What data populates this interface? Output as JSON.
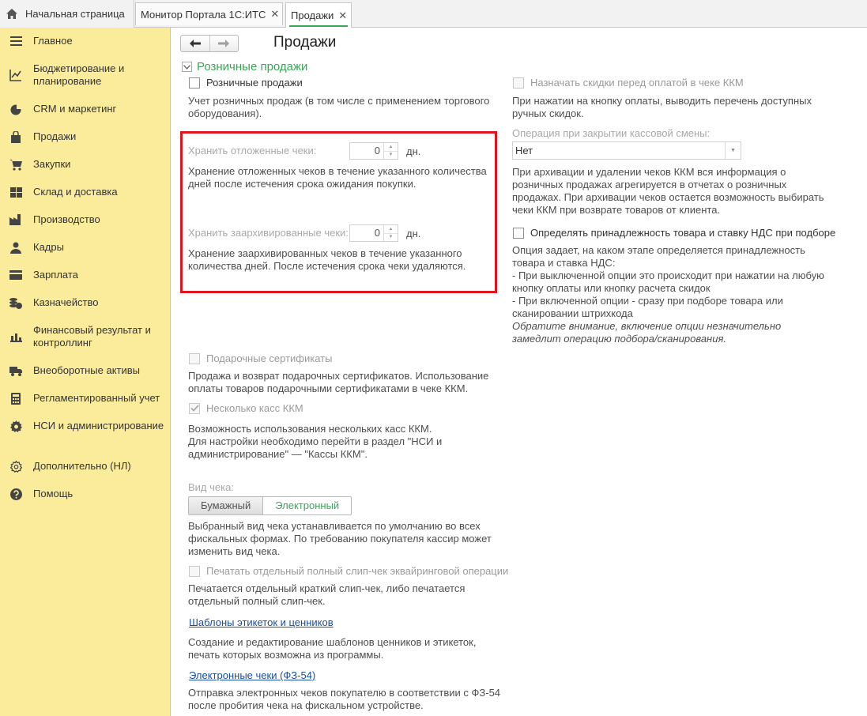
{
  "tabs": {
    "home": "Начальная страница",
    "portal_monitor": "Монитор Портала 1С:ИТС",
    "sales": "Продажи",
    "close_glyph": "✕"
  },
  "sidebar": {
    "items": [
      {
        "label": "Главное",
        "icon": "menu-lines-icon"
      },
      {
        "label": "Бюджетирование и планирование",
        "icon": "budget-chart-icon"
      },
      {
        "label": "CRM и маркетинг",
        "icon": "pie-chart-icon"
      },
      {
        "label": "Продажи",
        "icon": "shopping-bag-icon"
      },
      {
        "label": "Закупки",
        "icon": "cart-icon"
      },
      {
        "label": "Склад и доставка",
        "icon": "warehouse-grid-icon"
      },
      {
        "label": "Производство",
        "icon": "factory-icon"
      },
      {
        "label": "Кадры",
        "icon": "person-icon"
      },
      {
        "label": "Зарплата",
        "icon": "wallet-icon"
      },
      {
        "label": "Казначейство",
        "icon": "coins-icon"
      },
      {
        "label": "Финансовый результат и контроллинг",
        "icon": "bar-chart-icon"
      },
      {
        "label": "Внеоборотные активы",
        "icon": "truck-icon"
      },
      {
        "label": "Регламентированный учет",
        "icon": "calculator-icon"
      },
      {
        "label": "НСИ и администрирование",
        "icon": "gear-icon"
      },
      {
        "label": "Дополнительно (НЛ)",
        "icon": "gear-outline-icon"
      },
      {
        "label": "Помощь",
        "icon": "question-icon"
      }
    ]
  },
  "page": {
    "title": "Продажи",
    "group_title": "Розничные продажи",
    "retail_sales_checkbox": "Розничные продажи",
    "retail_sales_desc": [
      "Учет розничных продаж (в том числе с применением торгового",
      "оборудования)."
    ],
    "keep_deferred_label": "Хранить отложенные чеки:",
    "keep_deferred_value": "0",
    "keep_deferred_unit": "дн.",
    "keep_deferred_desc": [
      "Хранение отложенных чеков в течение указанного количества",
      "дней после истечения срока ожидания покупки."
    ],
    "keep_archived_label": "Хранить заархивированные чеки:",
    "keep_archived_value": "0",
    "keep_archived_unit": "дн.",
    "keep_archived_desc": [
      "Хранение заархивированных чеков в течение указанного",
      "количества дней. После истечения срока чеки удаляются."
    ],
    "gift_cert_checkbox": "Подарочные сертификаты",
    "gift_cert_desc": [
      "Продажа и возврат подарочных сертификатов. Использование",
      "оплаты товаров подарочными сертификатами в чеке ККМ."
    ],
    "multi_kkm_checkbox": "Несколько касс ККМ",
    "multi_kkm_desc": [
      "Возможность использования нескольких касс ККМ.",
      "Для настройки необходимо перейти в раздел \"НСИ и",
      "администрирование\" — \"Кассы ККМ\"."
    ],
    "receipt_type_label": "Вид чека:",
    "receipt_type_paper": "Бумажный",
    "receipt_type_electronic": "Электронный",
    "receipt_type_desc": [
      "Выбранный вид чека устанавливается по умолчанию во всех",
      "фискальных формах. По требованию покупателя кассир может",
      "изменить вид чека."
    ],
    "slip_checkbox": "Печатать отдельный полный слип-чек эквайринговой операции",
    "slip_desc": [
      "Печатается отдельный краткий слип-чек, либо печатается",
      "отдельный полный слип-чек."
    ],
    "templates_link": "Шаблоны этикеток и ценников",
    "templates_desc": [
      "Создание и редактирование шаблонов ценников и этикеток,",
      "печать которых возможна из программы."
    ],
    "e_receipts_link": "Электронные чеки (ФЗ-54)",
    "e_receipts_desc": [
      "Отправка электронных чеков покупателю в соответствии с ФЗ-54",
      "после пробития чека на фискальном устройстве."
    ],
    "discounts_checkbox": "Назначать скидки перед оплатой в чеке ККМ",
    "discounts_desc": [
      "При нажатии на кнопку оплаты, выводить перечень доступных",
      "ручных скидок."
    ],
    "shift_close_label": "Операция при закрытии кассовой смены:",
    "shift_close_value": "Нет",
    "shift_close_desc": [
      "При архивации и удалении чеков ККМ вся информация о",
      "розничных продажах агрегируется в отчетах о розничных",
      "продажах. При архивации чеков остается возможность выбирать",
      "чеки ККМ при возврате товаров от клиента."
    ],
    "vat_checkbox": "Определять принадлежность товара и ставку НДС при подборе",
    "vat_desc": [
      "Опция задает, на каком этапе определяется принадлежность",
      "товара и ставка НДС:",
      "- При выключенной опции это происходит при нажатии на любую",
      "кнопку оплаты или кнопку расчета скидок",
      "- При включенной опции - сразу при подборе товара или",
      "сканировании штрихкода"
    ],
    "vat_note": [
      "Обратите внимание, включение опции незначительно",
      "замедлит операцию подбора/сканирования."
    ]
  }
}
